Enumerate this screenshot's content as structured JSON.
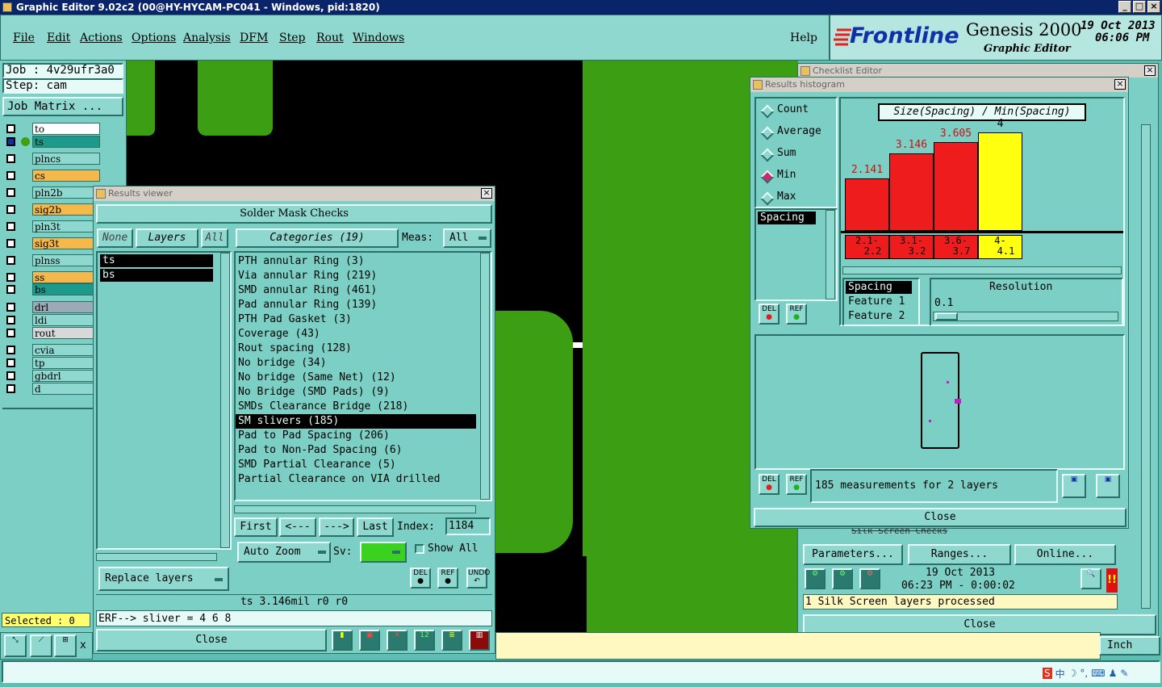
{
  "app": {
    "title": "Graphic Editor 9.02c2 (00@HY-HYCAM-PC041 - Windows, pid:1820)"
  },
  "menu": {
    "items": [
      "File",
      "Edit",
      "Actions",
      "Options",
      "Analysis",
      "DFM",
      "Step",
      "Rout",
      "Windows"
    ],
    "help": "Help"
  },
  "brand": {
    "logo": "Frontline",
    "product": "Genesis 2000",
    "subtitle": "Graphic Editor",
    "date": "19 Oct 2013",
    "time": "06:06 PM"
  },
  "job": {
    "job_label": "Job : 4v29ufr3a0",
    "step_label": "Step: cam",
    "matrix_button": "Job Matrix ..."
  },
  "layers": [
    {
      "name": "to",
      "color": "#ffffff"
    },
    {
      "name": "ts",
      "color": "#1e9a8a"
    },
    {
      "name": "plncs",
      "color": "#8fd8cf"
    },
    {
      "name": "cs",
      "color": "#f5b84a"
    },
    {
      "name": "pln2b",
      "color": "#8fd8cf"
    },
    {
      "name": "sig2b",
      "color": "#f5b84a"
    },
    {
      "name": "pln3t",
      "color": "#8fd8cf"
    },
    {
      "name": "sig3t",
      "color": "#f5b84a"
    },
    {
      "name": "plnss",
      "color": "#8fd8cf"
    },
    {
      "name": "ss",
      "color": "#f5b84a"
    },
    {
      "name": "bs",
      "color": "#1e9a8a"
    },
    {
      "name": "drl",
      "color": "#9aaab6"
    },
    {
      "name": "ldi",
      "color": "#8fd8cf"
    },
    {
      "name": "rout",
      "color": "#d8d8d8"
    },
    {
      "name": "cvia",
      "color": "#8fd8cf"
    },
    {
      "name": "tp",
      "color": "#8fd8cf"
    },
    {
      "name": "gbdrl",
      "color": "#8fd8cf"
    },
    {
      "name": "d",
      "color": "#8fd8cf"
    }
  ],
  "status": {
    "selected": "Selected : 0",
    "x_label": "x",
    "units": "Inch"
  },
  "results_viewer": {
    "title": "Results viewer",
    "header": "Solder Mask Checks",
    "none_btn": "None",
    "layers_btn": "Layers",
    "all_btn": "All",
    "categories_btn": "Categories (19)",
    "meas_label": "Meas:",
    "meas_value": "All",
    "layer_list": [
      "ts",
      "bs"
    ],
    "categories": [
      "PTH annular Ring (3)",
      "Via annular Ring (219)",
      "SMD annular Ring (461)",
      "Pad annular Ring (139)",
      "PTH Pad Gasket (3)",
      "Coverage (43)",
      "Rout spacing (128)",
      "No bridge (34)",
      "No bridge (Same Net) (12)",
      "No Bridge (SMD Pads) (9)",
      "SMDs Clearance Bridge (218)",
      "SM slivers (185)",
      "Pad to Pad Spacing (206)",
      "Pad to Non-Pad Spacing (6)",
      "SMD Partial Clearance (5)",
      "Partial Clearance on VIA drilled"
    ],
    "selected_index": 11,
    "nav": {
      "first": "First",
      "prev": "<---",
      "next": "--->",
      "last": "Last",
      "index_label": "Index:",
      "index_value": "1184"
    },
    "auto_zoom": "Auto Zoom",
    "sv_label": "Sv:",
    "show_all": "Show All",
    "replace_layers": "Replace layers",
    "icons": {
      "del": "DEL",
      "ref": "REF",
      "undo": "UNDO"
    },
    "measure_line": "ts 3.146mil  r0  r0",
    "erf_line": "ERF--> sliver = 4 6 8",
    "close": "Close"
  },
  "histogram": {
    "title": "Results histogram",
    "checklist_title": "Checklist Editor",
    "modes": [
      "Count",
      "Average",
      "Sum",
      "Min",
      "Max"
    ],
    "mode_selected": 3,
    "metric_list": [
      "Spacing"
    ],
    "chart_title": "Size(Spacing) / Min(Spacing)",
    "features": [
      "Spacing",
      "Feature 1",
      "Feature 2"
    ],
    "resolution_label": "Resolution",
    "resolution_value": "0.1",
    "summary": "185 measurements for 2 layers",
    "close": "Close"
  },
  "chart_data": {
    "type": "bar",
    "title": "Size(Spacing) / Min(Spacing)",
    "categories": [
      "2.1-2.2",
      "3.1-3.2",
      "3.6-3.7",
      "4-4.1"
    ],
    "bin_labels": [
      [
        "2.1-",
        "2.2"
      ],
      [
        "3.1-",
        "3.2"
      ],
      [
        "3.6-",
        "3.7"
      ],
      [
        "4-",
        "4.1"
      ]
    ],
    "values": [
      2.141,
      3.146,
      3.605,
      4
    ],
    "value_labels": [
      "2.141",
      "3.146",
      "3.605",
      "4"
    ],
    "colors": [
      "#ee1c1c",
      "#ee1c1c",
      "#ee1c1c",
      "#ffff10"
    ],
    "ylim": [
      0,
      4.4
    ]
  },
  "checklist": {
    "row": "Silk Screen Checks",
    "parameters": "Parameters...",
    "ranges": "Ranges...",
    "online": "Online...",
    "date": "19 Oct 2013",
    "time": "06:23 PM - 0:00:02",
    "message": "1 Silk Screen layers processed",
    "close": "Close"
  }
}
